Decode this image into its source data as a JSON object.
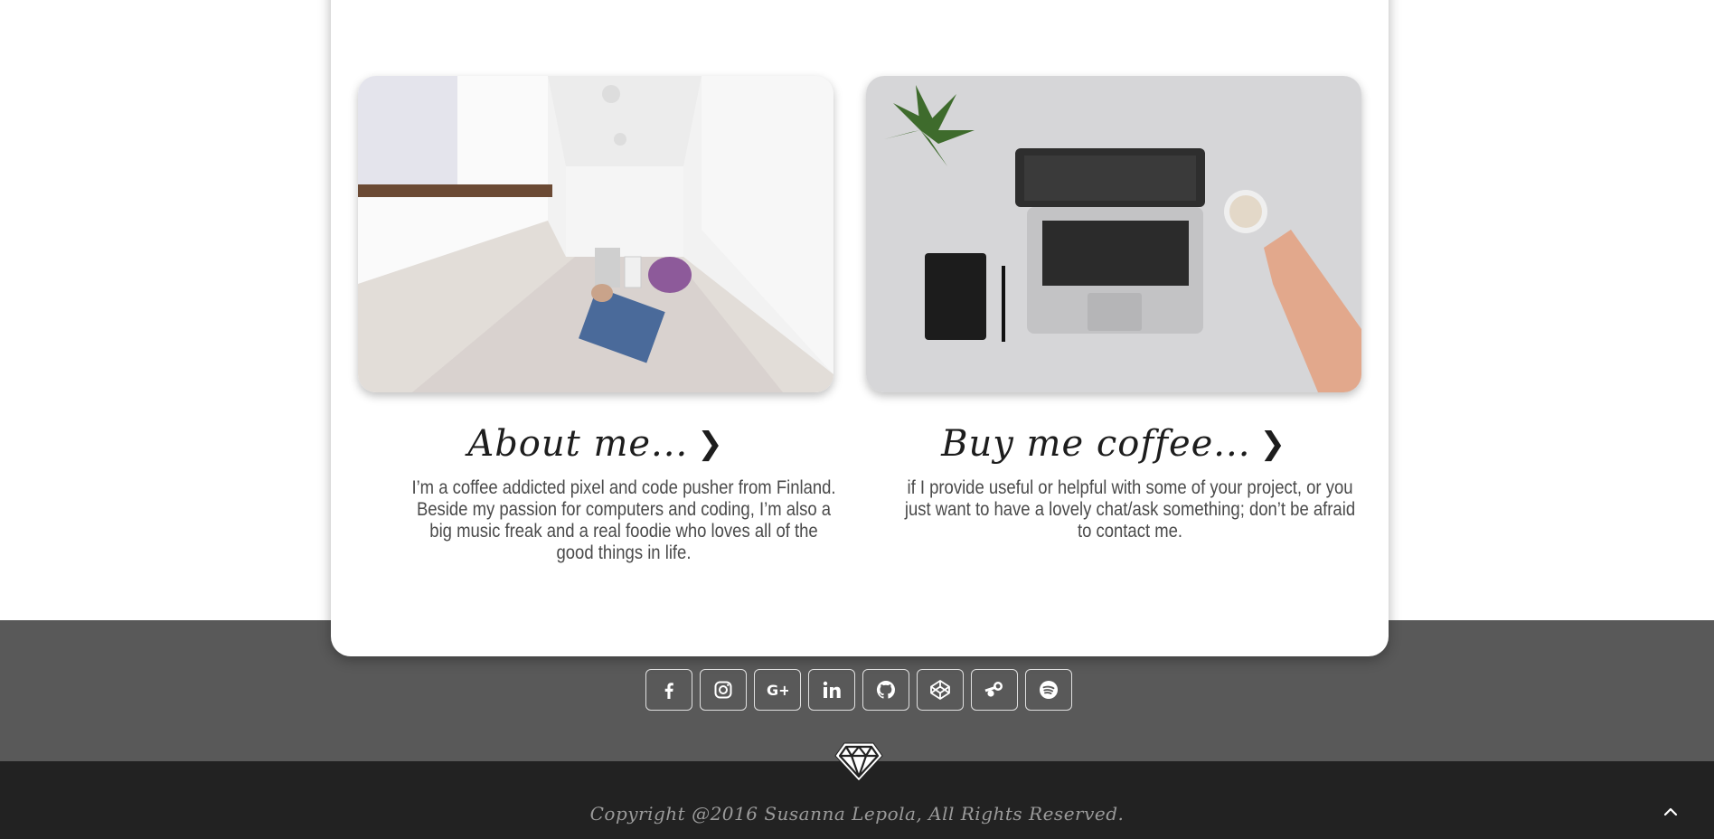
{
  "tiles": [
    {
      "title": "About me...",
      "text": "I’m a coffee addicted pixel and code pusher from Finland. Beside my passion for computers and coding, I’m also a big music freak and a real foodie who loves all of the good things in life.",
      "image_icon": "room-photo",
      "chevron_icon": "chevron-right-icon"
    },
    {
      "title": "Buy me coffee...",
      "text": "if I provide useful or helpful with some of your project, or you just want to have a lovely chat/ask something; don’t be afraid to contact me.",
      "image_icon": "laptop-coffee-photo",
      "chevron_icon": "chevron-right-icon"
    }
  ],
  "socials": [
    {
      "icon": "facebook-icon"
    },
    {
      "icon": "instagram-icon"
    },
    {
      "icon": "google-plus-icon"
    },
    {
      "icon": "linkedin-icon"
    },
    {
      "icon": "github-icon"
    },
    {
      "icon": "codepen-icon"
    },
    {
      "icon": "steam-icon"
    },
    {
      "icon": "spotify-icon"
    }
  ],
  "footer": {
    "copyright": "Copyright @2016 Susanna Lepola, All Rights Reserved.",
    "logo_icon": "diamond-icon",
    "scroll_top_icon": "chevron-up-icon"
  },
  "colors": {
    "grey_band": "#595959",
    "dark_band": "#222222",
    "card": "#ffffff",
    "text": "#4a4a4a"
  }
}
